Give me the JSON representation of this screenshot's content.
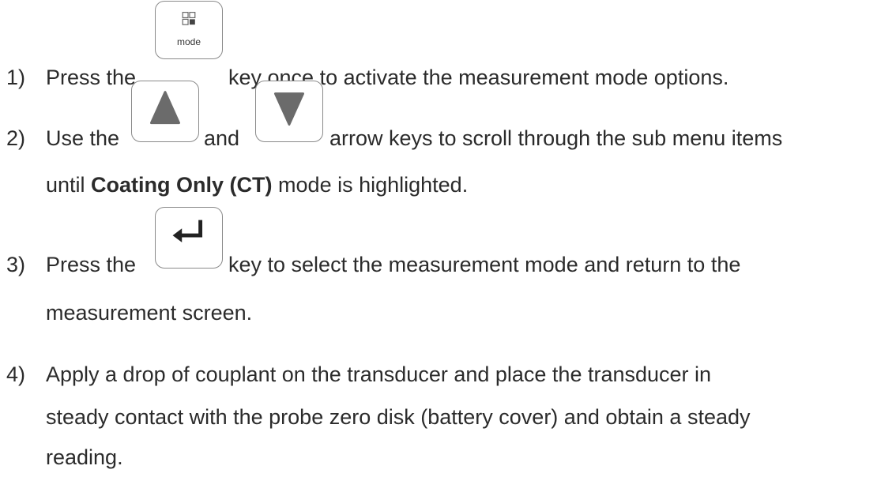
{
  "steps": [
    {
      "number": "1)",
      "before": "Press the",
      "key_label": "mode",
      "after": "key once to activate the measurement mode options."
    },
    {
      "number": "2)",
      "before": "Use the",
      "between": "and",
      "after": "arrow keys to scroll through the sub menu items",
      "line2_before": "until",
      "line2_bold": "Coating Only (CT)",
      "line2_after": "mode is highlighted."
    },
    {
      "number": "3)",
      "before": "Press the",
      "after": "key to select the measurement mode and return to the",
      "line2": "measurement screen."
    },
    {
      "number": "4)",
      "line1": "Apply a drop of couplant on the transducer and place the transducer in",
      "line2": "steady contact with the probe zero disk (battery cover) and obtain a steady",
      "line3": "reading."
    }
  ],
  "icons": {
    "mode_key": "mode-grid-icon",
    "up_key": "up-arrow-icon",
    "down_key": "down-arrow-icon",
    "enter_key": "enter-return-icon"
  }
}
